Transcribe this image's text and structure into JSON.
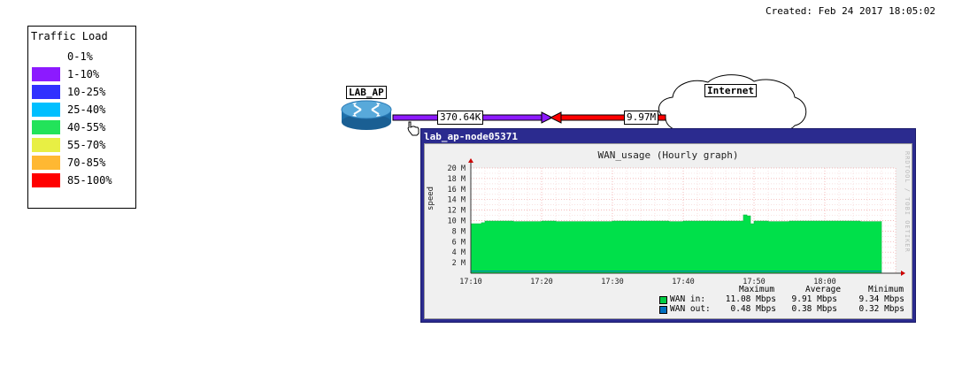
{
  "header": {
    "created": "Created: Feb 24 2017 18:05:02"
  },
  "legend": {
    "title": "Traffic Load",
    "items": [
      {
        "label": "0-1%",
        "color": "#ffffff"
      },
      {
        "label": "1-10%",
        "color": "#8c1aff"
      },
      {
        "label": "10-25%",
        "color": "#3030ff"
      },
      {
        "label": "25-40%",
        "color": "#00bfff"
      },
      {
        "label": "40-55%",
        "color": "#22e35a"
      },
      {
        "label": "55-70%",
        "color": "#e8ef44"
      },
      {
        "label": "70-85%",
        "color": "#ffb832"
      },
      {
        "label": "85-100%",
        "color": "#ff0000"
      }
    ]
  },
  "map": {
    "node_lab_ap": "LAB_AP",
    "node_internet": "Internet",
    "link_out_label": "370.64K",
    "link_in_label": "9.97M",
    "link_out_color": "#8c1aff",
    "link_in_color": "#ff0000"
  },
  "popup": {
    "title": "lab_ap-node05371",
    "graph_title": "WAN_usage (Hourly graph)",
    "ylabel": "speed",
    "credit": "RRDTOOL / TOBI OETIKER",
    "stat_headers": [
      "Maximum",
      "Average",
      "Minimum"
    ],
    "series": [
      {
        "name": "WAN in:",
        "color": "#00cc44",
        "max": "11.08 Mbps",
        "avg": "9.91 Mbps",
        "min": "9.34 Mbps"
      },
      {
        "name": "WAN out:",
        "color": "#0070c0",
        "max": "0.48 Mbps",
        "avg": "0.38 Mbps",
        "min": "0.32 Mbps"
      }
    ]
  },
  "chart_data": {
    "type": "area",
    "title": "WAN_usage (Hourly graph)",
    "ylabel": "speed",
    "xlabel": "",
    "x_ticks": [
      "17:10",
      "17:20",
      "17:30",
      "17:40",
      "17:50",
      "18:00"
    ],
    "y_ticks": [
      "2 M",
      "4 M",
      "6 M",
      "8 M",
      "10 M",
      "12 M",
      "14 M",
      "16 M",
      "18 M",
      "20 M"
    ],
    "ylim": [
      0,
      20
    ],
    "xlim_minutes": [
      0,
      60
    ],
    "series": [
      {
        "name": "WAN in",
        "color": "#00e04a",
        "x_minutes": [
          0,
          1.5,
          2,
          5,
          6,
          10,
          12,
          15,
          20,
          25,
          28,
          30,
          35,
          38,
          38.5,
          39,
          39.5,
          40,
          42,
          45,
          50,
          55,
          58
        ],
        "values": [
          9.4,
          9.6,
          9.9,
          9.9,
          9.8,
          9.9,
          9.8,
          9.8,
          9.9,
          9.9,
          9.8,
          9.9,
          9.9,
          9.9,
          11.08,
          10.9,
          9.4,
          9.9,
          9.8,
          9.9,
          9.9,
          9.8,
          9.9
        ]
      },
      {
        "name": "WAN out",
        "color": "#0070c0",
        "x_minutes": [
          0,
          58
        ],
        "values": [
          0.38,
          0.38
        ]
      }
    ]
  }
}
